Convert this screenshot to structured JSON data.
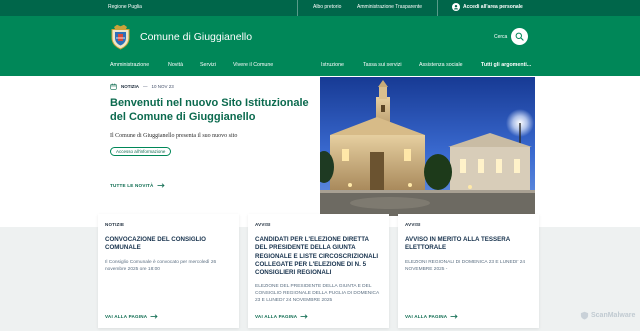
{
  "topbar": {
    "region": "Regione Puglia",
    "albo": "Albo pretorio",
    "amministrazione": "Amministrazione Trasparente",
    "login": "Accedi all'area personale"
  },
  "header": {
    "title": "Comune di Giuggianello",
    "search_label": "Cerca",
    "nav_left": [
      "Amministrazione",
      "Novità",
      "Servizi",
      "Vivere il Comune"
    ],
    "nav_right": [
      "Istruzione",
      "Tassa sui servizi",
      "Assistenza sociale",
      "Tutti gli argomenti..."
    ]
  },
  "hero": {
    "category": "NOTIZIA",
    "date": "10 NOV 23",
    "title": "Benvenuti nel nuovo Sito Istituzionale del Comune di Giuggianello",
    "subtitle": "Il Comune di Giuggianello presenta il suo nuovo sito",
    "tag": "Accesso all'informazione",
    "all_news": "TUTTE LE NOVITÀ"
  },
  "cards": [
    {
      "category": "NOTIZIE",
      "title": "CONVOCAZIONE DEL CONSIGLIO COMUNALE",
      "body": "Il Consiglio Comunale è convocato per mercoledì 26 novembre 2025 ore 18:00",
      "more": "VAI ALLA PAGINA"
    },
    {
      "category": "AVVISI",
      "title": "CANDIDATI PER L'ELEZIONE DIRETTA DEL PRESIDENTE DELLA GIUNTA REGIONALE E LISTE CIRCOSCRIZIONALI COLLEGATE PER L'ELEZIONE DI N. 5 CONSIGLIERI REGIONALI",
      "body": "ELEZIONE DEL PRESIDENTE DELLA GIUNTA E DEL CONSIGLIO REGIONALE DELLA PUGLIA DI DOMENICA 23 E LUNEDI' 24 NOVEMBRE 2025",
      "more": "VAI ALLA PAGINA"
    },
    {
      "category": "AVVISI",
      "title": "AVVISO IN MERITO ALLA TESSERA ELETTORALE",
      "body": "ELEZIONI REGIONALI DI DOMENICA 23 E LUNEDI' 24 NOVEMBRE 2025 -",
      "more": "VAI ALLA PAGINA"
    }
  ],
  "watermark": "ScanMalware",
  "colors": {
    "primary": "#008758",
    "topbar": "#00664a",
    "accent_text": "#0b6a4e",
    "band": "#eef1f1"
  }
}
